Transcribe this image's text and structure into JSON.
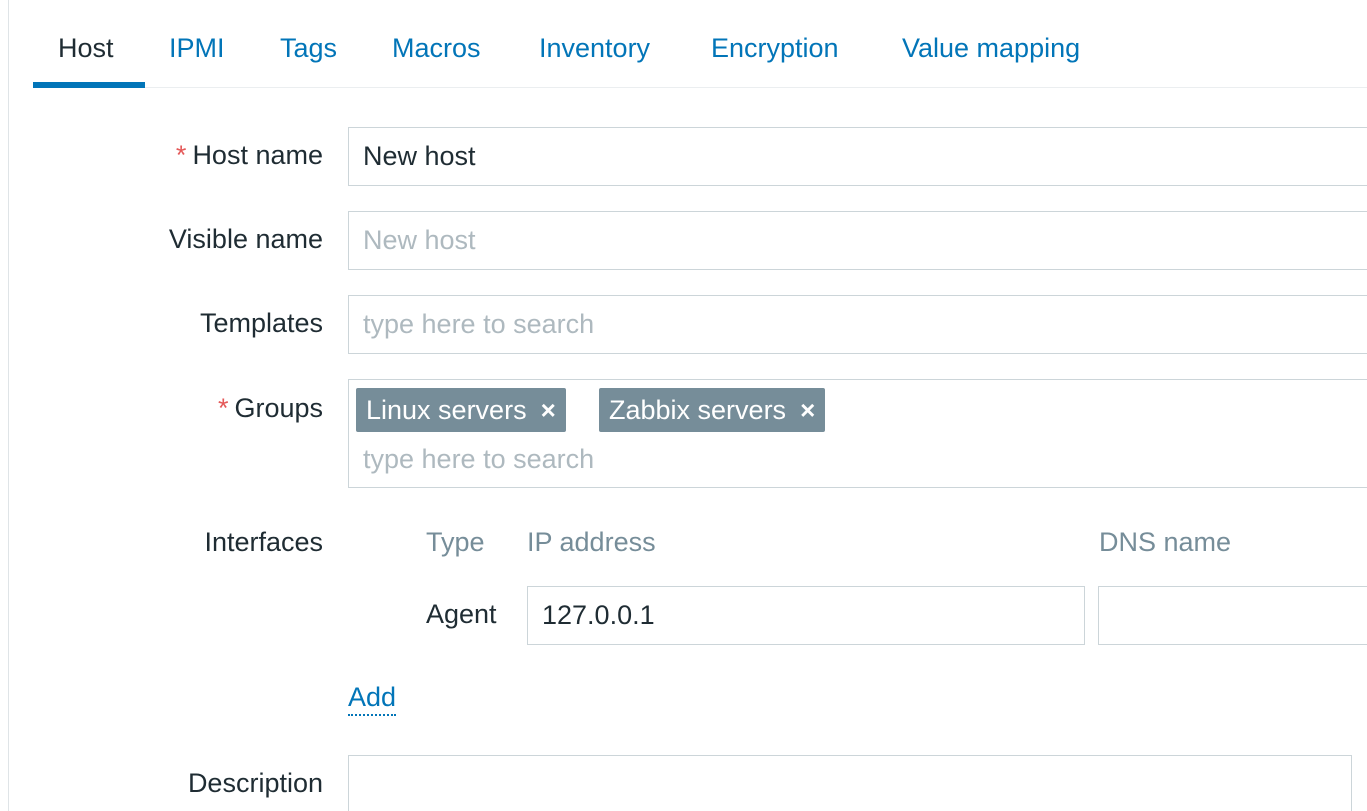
{
  "tabs": [
    {
      "label": "Host",
      "active": true
    },
    {
      "label": "IPMI"
    },
    {
      "label": "Tags"
    },
    {
      "label": "Macros"
    },
    {
      "label": "Inventory"
    },
    {
      "label": "Encryption"
    },
    {
      "label": "Value mapping"
    }
  ],
  "form": {
    "required_marker": "*",
    "host_name": {
      "label": "Host name",
      "value": "New host"
    },
    "visible_name": {
      "label": "Visible name",
      "placeholder": "New host"
    },
    "templates": {
      "label": "Templates",
      "placeholder": "type here to search"
    },
    "groups": {
      "label": "Groups",
      "chips": [
        {
          "label": "Linux servers",
          "remove_icon": "×"
        },
        {
          "label": "Zabbix servers",
          "remove_icon": "×"
        }
      ],
      "placeholder": "type here to search"
    },
    "interfaces": {
      "label": "Interfaces",
      "columns": {
        "type": "Type",
        "ip": "IP address",
        "dns": "DNS name"
      },
      "rows": [
        {
          "type": "Agent",
          "ip": "127.0.0.1",
          "dns": ""
        }
      ],
      "add_label": "Add"
    },
    "description": {
      "label": "Description",
      "value": ""
    }
  },
  "colors": {
    "accent": "#0275b8",
    "required": "#e45959",
    "chip_bg": "#768d99",
    "border": "#ccd5d9",
    "placeholder": "#aeb9bf"
  }
}
